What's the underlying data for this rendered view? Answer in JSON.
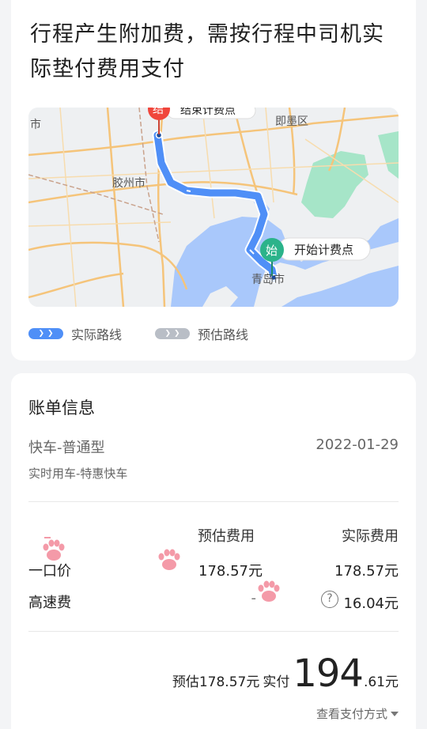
{
  "notice": {
    "text": "行程产生附加费，需按行程中司机实际垫付费用支付"
  },
  "map": {
    "end_marker": {
      "badge": "结",
      "label": "结束计费点"
    },
    "start_marker": {
      "badge": "始",
      "label": "开始计费点"
    },
    "places": {
      "jimo": "即墨区",
      "jiaozhou": "胶州市",
      "qingdao": "青岛市",
      "edge_city": "市"
    }
  },
  "legend": {
    "actual": "实际路线",
    "estimated": "预估路线"
  },
  "colors": {
    "route_actual": "#4f8ff7",
    "route_estimated": "#b9bec6",
    "start_marker": "#2bb38a",
    "end_marker": "#f0463c",
    "water": "#a9c8fb"
  },
  "bill": {
    "title": "账单信息",
    "service": "快车-普通型",
    "date": "2022-01-29",
    "subtype": "实时用车-特惠快车",
    "headers": {
      "estimated": "预估费用",
      "actual": "实际费用"
    },
    "rows": [
      {
        "label": "一口价",
        "estimated": "178.57元",
        "actual": "178.57元"
      },
      {
        "label": "高速费",
        "estimated": "-",
        "actual": "16.04元",
        "info_icon": "question-circle-icon"
      }
    ],
    "total": {
      "estimated_prefix": "预估178.57元",
      "actual_prefix": "实付",
      "amount_integer": "194",
      "amount_decimal": ".61元"
    },
    "payment_link": "查看支付方式"
  }
}
